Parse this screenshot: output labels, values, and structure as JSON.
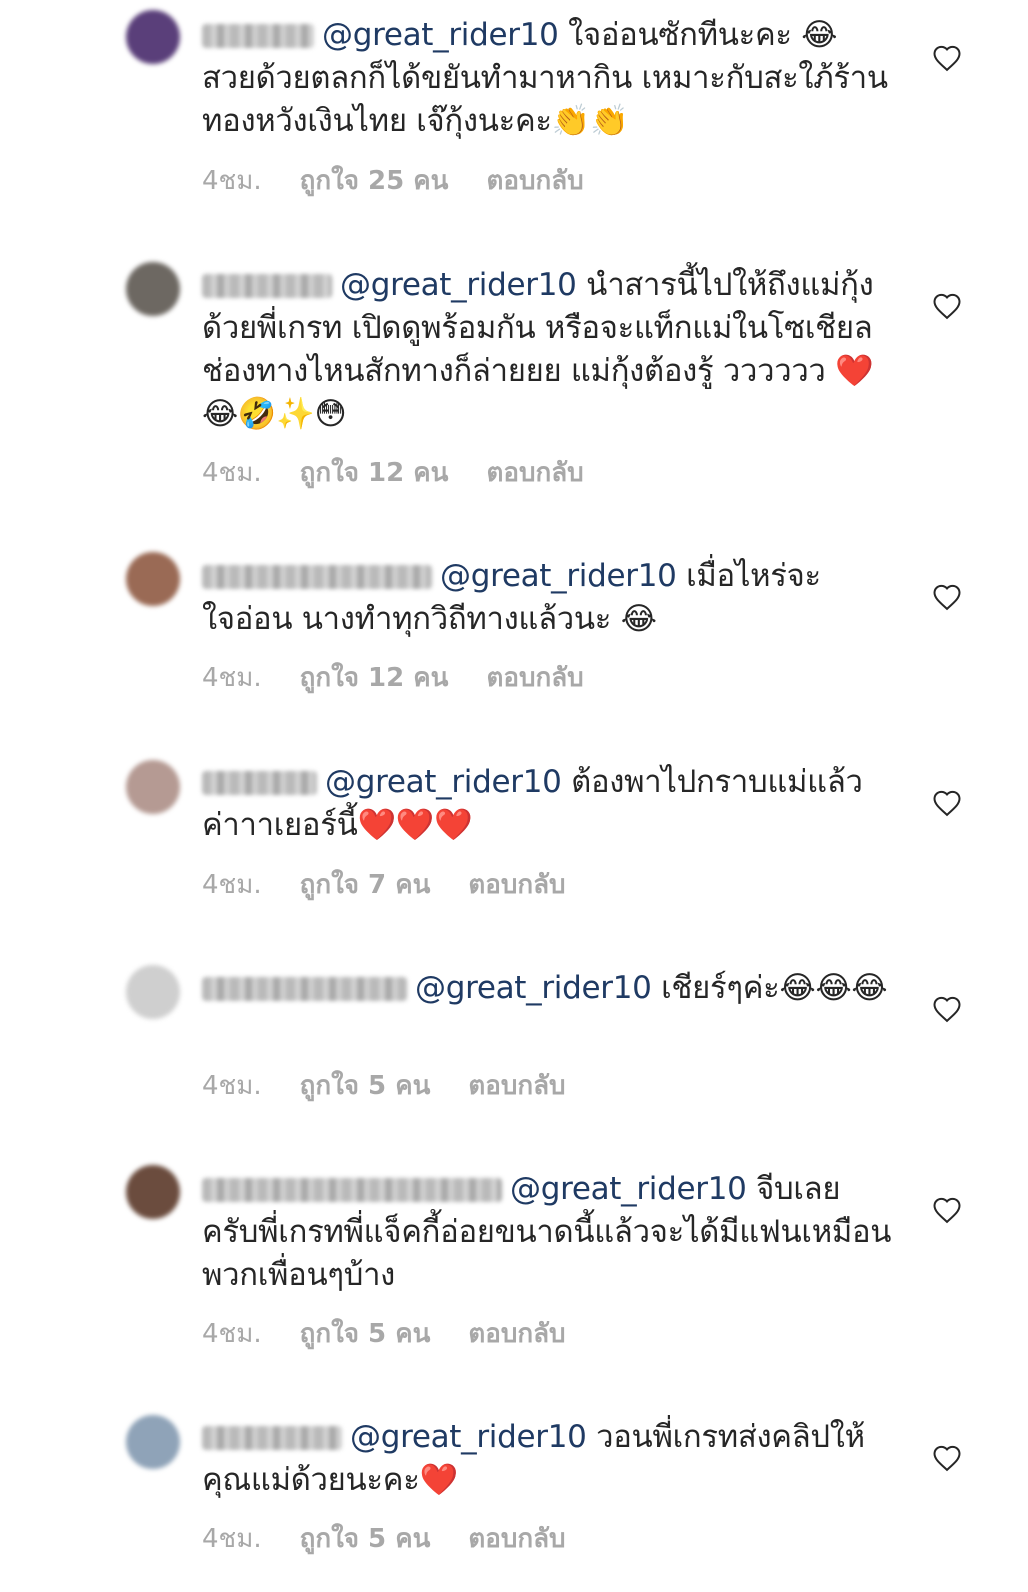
{
  "comments": [
    {
      "avatar_color": "#5a3f7a",
      "mention": "@great_rider10",
      "text": " ใจอ่อนซักทีนะคะ 😂 สวยด้วยตลกก็ได้ขยันทำมาหากิน เหมาะกับสะใภ้ร้านทองหวังเงินไทย เจ๊กุ้งนะคะ👏👏",
      "time": "4ชม.",
      "likes": "ถูกใจ 25 คน",
      "reply": "ตอบกลับ"
    },
    {
      "avatar_color": "#6d6862",
      "mention": "@great_rider10",
      "text": " นำสารนี้ไปให้ถึงแม่กุ้งด้วยพี่เกรท เปิดดูพร้อมกัน หรือจะแท็กแม่ในโซเชียลช่องทางไหนสักทางก็ล่ายยย แม่กุ้งต้องรู้ วววววว ❤️😂🤣✨😳",
      "time": "4ชม.",
      "likes": "ถูกใจ 12 คน",
      "reply": "ตอบกลับ"
    },
    {
      "avatar_color": "#9a6a55",
      "mention": "@great_rider10",
      "text": " เมื่อไหร่จะใจอ่อน นางทำทุกวิถีทางแล้วนะ 😂",
      "time": "4ชม.",
      "likes": "ถูกใจ 12 คน",
      "reply": "ตอบกลับ"
    },
    {
      "avatar_color": "#b59a93",
      "mention": "@great_rider10",
      "text": " ต้องพาไปกราบแม่แล้วค่าาาเยอร์นี้❤️❤️❤️",
      "time": "4ชม.",
      "likes": "ถูกใจ 7 คน",
      "reply": "ตอบกลับ"
    },
    {
      "avatar_color": "#cfcfcf",
      "mention": "@great_rider10",
      "text": " เชียร์ๆค่ะ😂😂😂",
      "time": "4ชม.",
      "likes": "ถูกใจ 5 คน",
      "reply": "ตอบกลับ"
    },
    {
      "avatar_color": "#6b4c3e",
      "mention": "@great_rider10",
      "text": " จีบเลยครับพี่เกรทพี่แจ็คกี้อ่อยขนาดนี้แล้วจะได้มีแฟนเหมือนพวกเพื่อนๆบ้าง",
      "time": "4ชม.",
      "likes": "ถูกใจ 5 คน",
      "reply": "ตอบกลับ"
    },
    {
      "avatar_color": "#8fa3b8",
      "mention": "@great_rider10",
      "text": " วอนพี่เกรทส่งคลิปให้คุณแม่ด้วยนะคะ❤️",
      "time": "4ชม.",
      "likes": "ถูกใจ 5 คน",
      "reply": "ตอบกลับ"
    }
  ]
}
